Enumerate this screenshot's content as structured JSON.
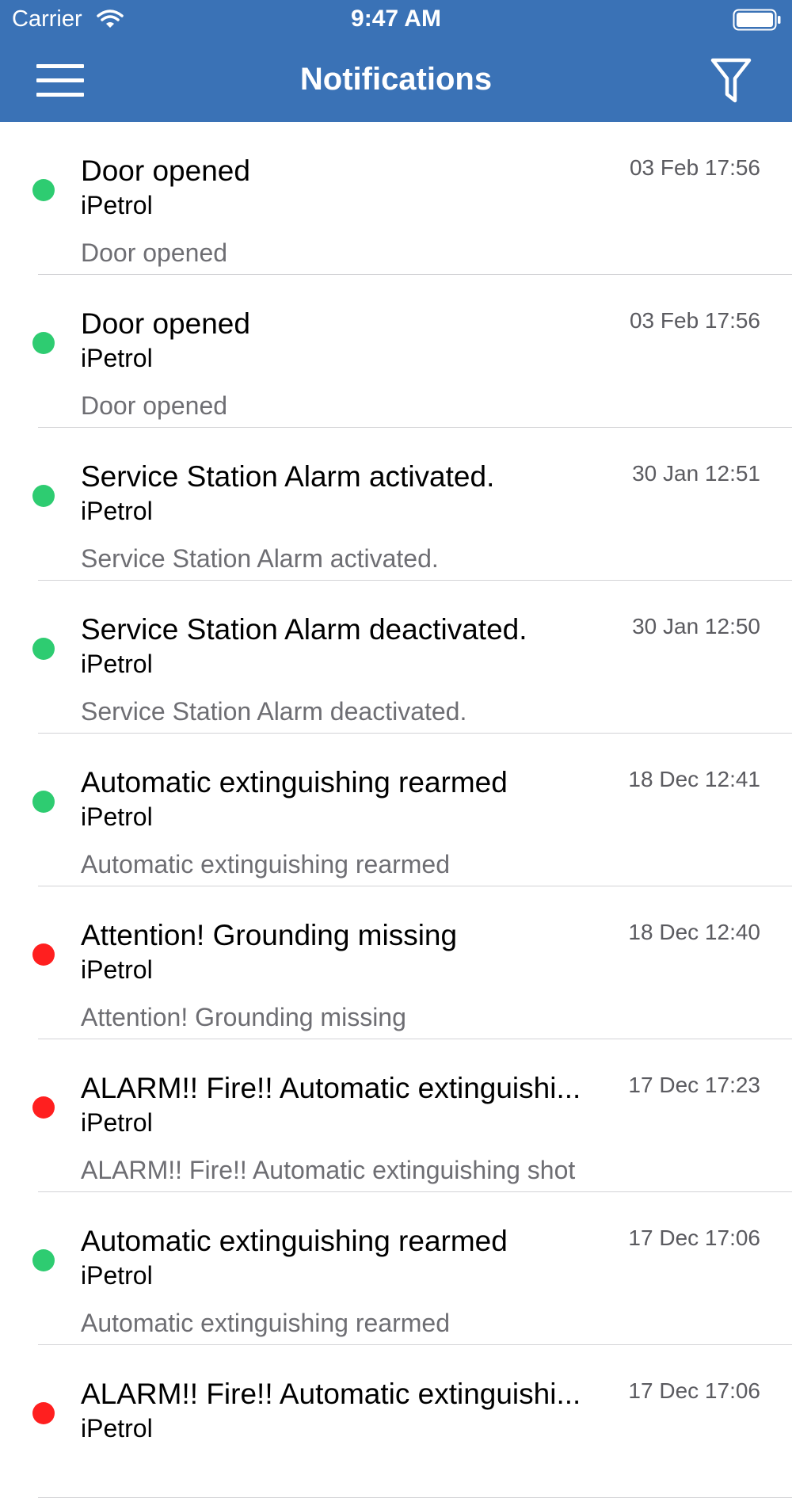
{
  "status_bar": {
    "carrier": "Carrier",
    "time": "9:47 AM"
  },
  "nav": {
    "title": "Notifications",
    "menu_icon": "hamburger-menu-icon",
    "filter_icon": "filter-icon"
  },
  "colors": {
    "header": "#3a72b6",
    "dot_green": "#2ecc71",
    "dot_red": "#ff1f1f"
  },
  "notifications": [
    {
      "title": "Door opened",
      "source": "iPetrol",
      "body": "Door opened",
      "time": "03 Feb 17:56",
      "status": "green"
    },
    {
      "title": "Door opened",
      "source": "iPetrol",
      "body": "Door opened",
      "time": "03 Feb 17:56",
      "status": "green"
    },
    {
      "title": "Service Station Alarm activated.",
      "source": "iPetrol",
      "body": "Service Station Alarm activated.",
      "time": "30 Jan 12:51",
      "status": "green"
    },
    {
      "title": "Service Station Alarm deactivated.",
      "source": "iPetrol",
      "body": "Service Station Alarm deactivated.",
      "time": "30 Jan 12:50",
      "status": "green"
    },
    {
      "title": "Automatic extinguishing rearmed",
      "source": "iPetrol",
      "body": "Automatic extinguishing rearmed",
      "time": "18 Dec 12:41",
      "status": "green"
    },
    {
      "title": "Attention! Grounding missing",
      "source": "iPetrol",
      "body": "Attention! Grounding missing",
      "time": "18 Dec 12:40",
      "status": "red"
    },
    {
      "title": "ALARM!! Fire!! Automatic extinguishi...",
      "source": "iPetrol",
      "body": "ALARM!! Fire!! Automatic extinguishing shot",
      "time": "17 Dec 17:23",
      "status": "red"
    },
    {
      "title": "Automatic extinguishing rearmed",
      "source": "iPetrol",
      "body": "Automatic extinguishing rearmed",
      "time": "17 Dec 17:06",
      "status": "green"
    },
    {
      "title": "ALARM!! Fire!! Automatic extinguishi...",
      "source": "iPetrol",
      "body": "",
      "time": "17 Dec 17:06",
      "status": "red"
    }
  ]
}
